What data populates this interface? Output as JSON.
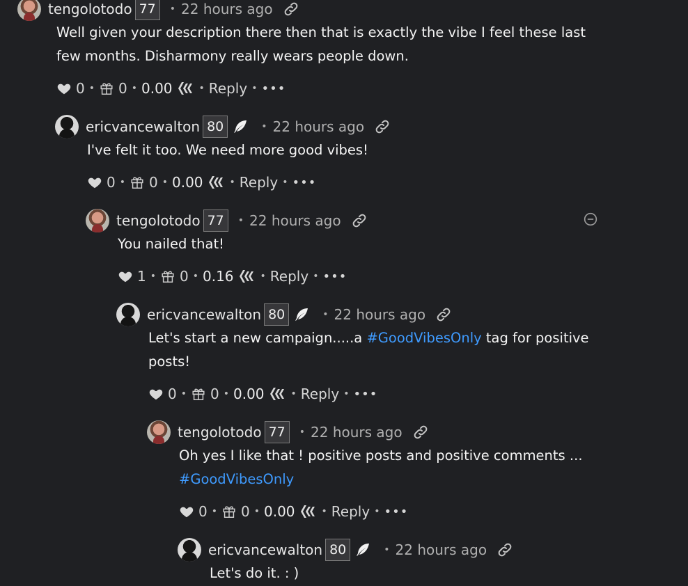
{
  "comments": [
    {
      "author": "tengolotodo",
      "reputation": "77",
      "time": "22 hours ago",
      "body": [
        "Well given your description there then that is exactly the vibe I feel these last",
        "few months. Disharmony really wears people down."
      ],
      "votes": "0",
      "tips": "0",
      "payout": "0.00",
      "reply_label": "Reply"
    },
    {
      "author": "ericvancewalton",
      "reputation": "80",
      "time": "22 hours ago",
      "body": [
        "I've felt it too. We need more good vibes!"
      ],
      "votes": "0",
      "tips": "0",
      "payout": "0.00",
      "reply_label": "Reply"
    },
    {
      "author": "tengolotodo",
      "reputation": "77",
      "time": "22 hours ago",
      "body": [
        "You nailed that!"
      ],
      "votes": "1",
      "tips": "0",
      "payout": "0.16",
      "reply_label": "Reply"
    },
    {
      "author": "ericvancewalton",
      "reputation": "80",
      "time": "22 hours ago",
      "body_pre": "Let's start a new campaign.....a ",
      "tag": "#GoodVibesOnly",
      "body_post": " tag for positive",
      "body_line2": "posts!",
      "votes": "0",
      "tips": "0",
      "payout": "0.00",
      "reply_label": "Reply"
    },
    {
      "author": "tengolotodo",
      "reputation": "77",
      "time": "22 hours ago",
      "body_line1": "Oh yes I like that ! positive posts and positive comments ...",
      "tag": "#GoodVibesOnly",
      "votes": "0",
      "tips": "0",
      "payout": "0.00",
      "reply_label": "Reply"
    },
    {
      "author": "ericvancewalton",
      "reputation": "80",
      "time": "22 hours ago",
      "body": [
        "Let's do it. : )"
      ]
    }
  ],
  "separator": "•",
  "more_label": "•••",
  "icons": {
    "vote": "heart-icon",
    "tip": "gift-icon",
    "currency": "hive-icon",
    "link": "link-icon",
    "badge": "feather-icon",
    "collapse": "collapse-icon"
  }
}
